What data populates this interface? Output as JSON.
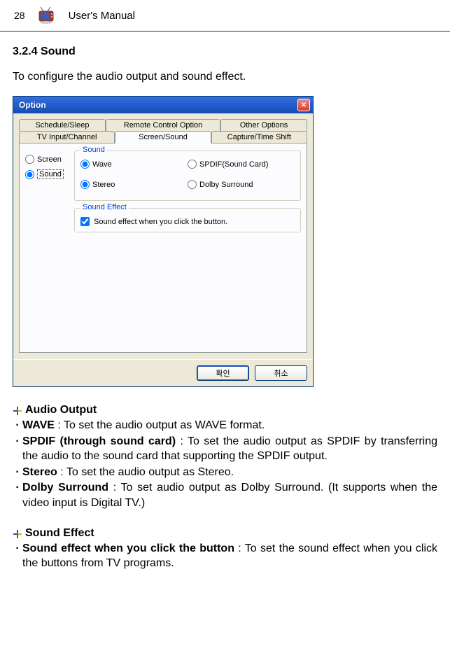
{
  "header": {
    "page_number": "28",
    "title": "User's Manual"
  },
  "section": {
    "heading": "3.2.4   Sound",
    "intro": "To configure the audio output and sound effect."
  },
  "dialog": {
    "title": "Option",
    "tabs_row1": [
      "Schedule/Sleep",
      "Remote Control Option",
      "Other Options"
    ],
    "tabs_row2": [
      "TV Input/Channel",
      "Screen/Sound",
      "Capture/Time Shift"
    ],
    "left": {
      "screen": "Screen",
      "sound": "Sound"
    },
    "sound_group": {
      "legend": "Sound",
      "wave": "Wave",
      "spdif": "SPDIF(Sound Card)",
      "stereo": "Stereo",
      "dolby": "Dolby Surround"
    },
    "effect_group": {
      "legend": "Sound Effect",
      "checkbox": "Sound effect when you click the button."
    },
    "buttons": {
      "ok": "확인",
      "cancel": "취소"
    }
  },
  "lists": {
    "audio_output": {
      "heading": "Audio Output",
      "items": [
        {
          "term": "WAVE",
          "desc": " : To set the audio output as WAVE format."
        },
        {
          "term": "SPDIF (through sound card)",
          "desc": " : To set the audio output as SPDIF by transferring the audio to the sound card that supporting the SPDIF output."
        },
        {
          "term": "Stereo",
          "desc": " : To set the audio output as Stereo."
        },
        {
          "term": "Dolby Surround",
          "desc": " : To set audio output as Dolby Surround. (It supports when the video input is Digital TV.)"
        }
      ]
    },
    "sound_effect": {
      "heading": "Sound Effect",
      "items": [
        {
          "term": "Sound effect when you click the button",
          "desc": " : To set the sound effect when you click the buttons from TV programs."
        }
      ]
    }
  }
}
